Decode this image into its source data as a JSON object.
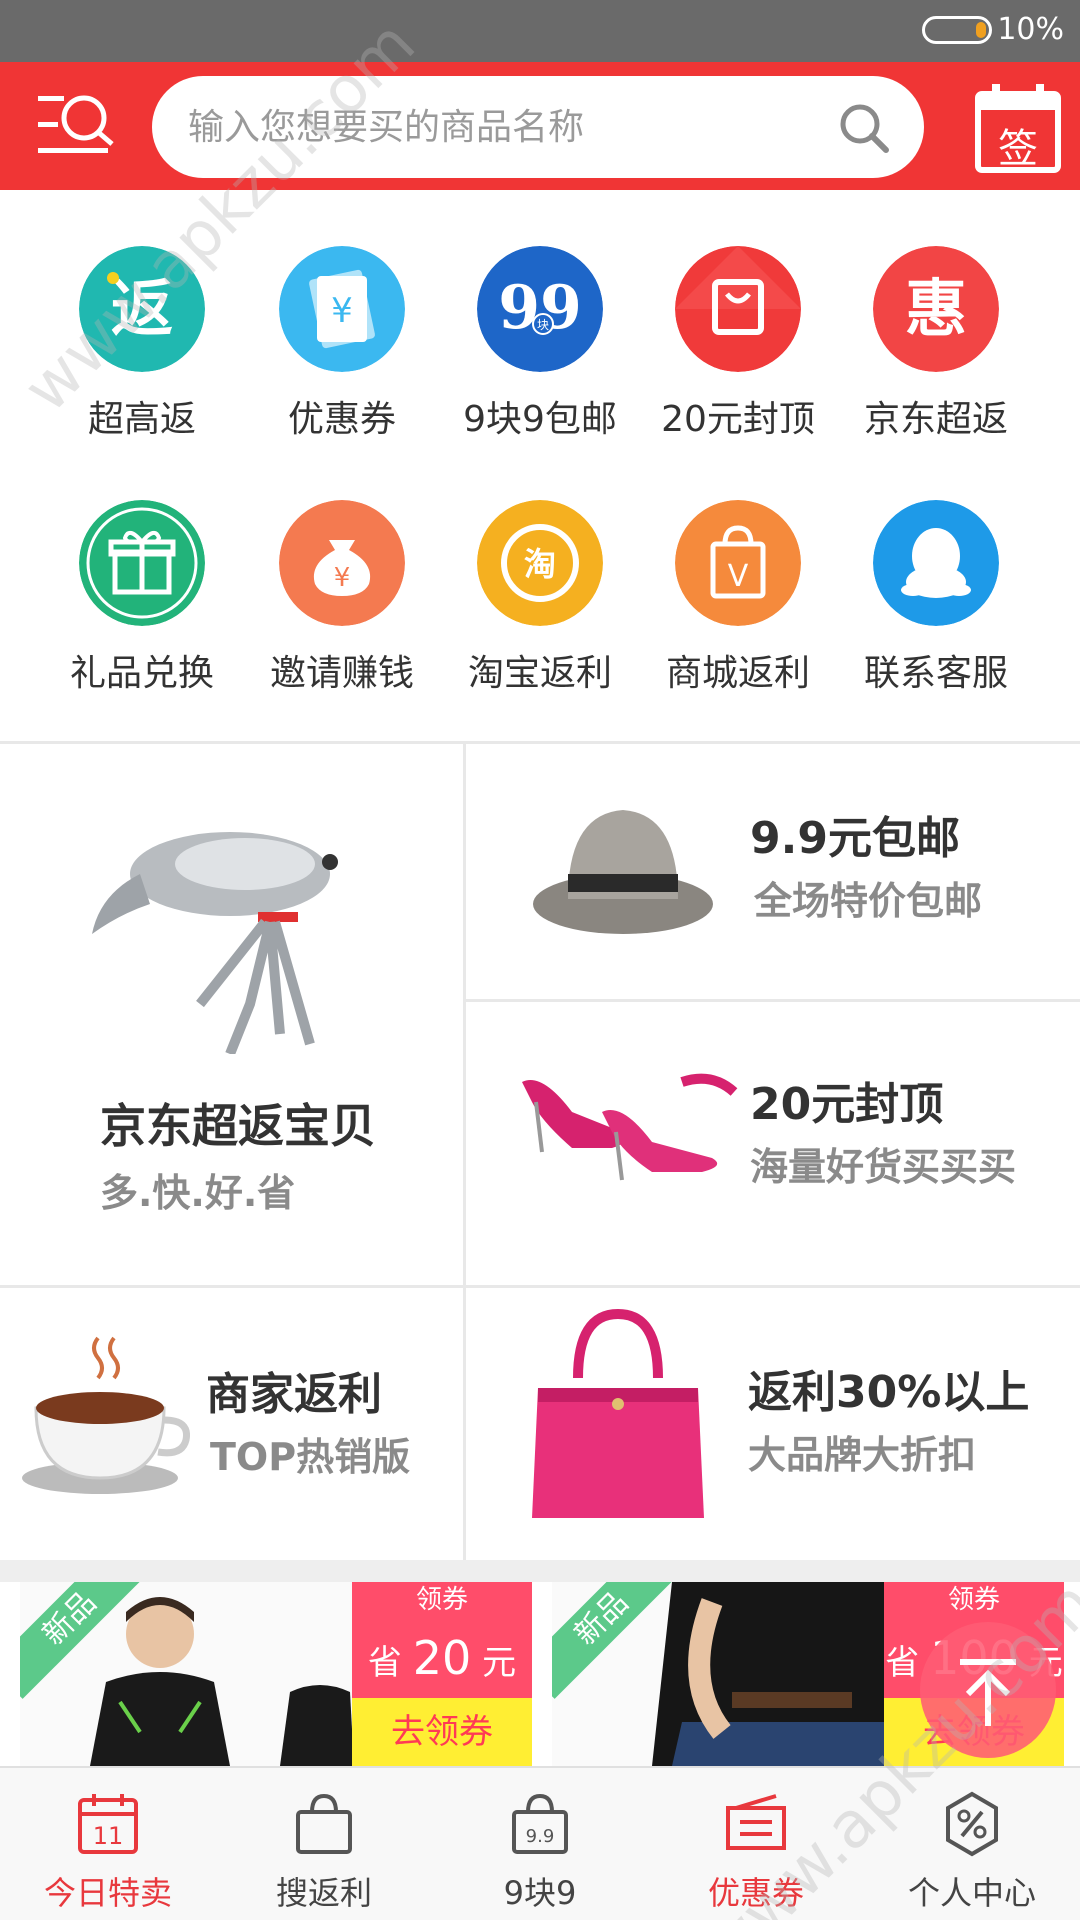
{
  "status_bar": {
    "battery_percent": "10%",
    "battery_level": 0.1
  },
  "header": {
    "search_placeholder": "输入您想要买的商品名称",
    "sign_label": "签",
    "icons": {
      "menu": "search-menu-icon",
      "search": "search-icon",
      "sign": "calendar-sign-icon"
    }
  },
  "grid": {
    "items": [
      {
        "label": "超高返",
        "icon": "fan-icon",
        "glyph": "返",
        "color": "#20b8b0"
      },
      {
        "label": "优惠券",
        "icon": "coupon-ticket-icon",
        "glyph": "¥",
        "color": "#3bb8f0"
      },
      {
        "label": "9块9包邮",
        "icon": "nine-nine-icon",
        "glyph": "99",
        "sub_glyph": "块",
        "color": "#1e66c8"
      },
      {
        "label": "20元封顶",
        "icon": "bag-icon",
        "color": "#f03a3a"
      },
      {
        "label": "京东超返",
        "icon": "hui-icon",
        "glyph": "惠",
        "color": "#f24545"
      },
      {
        "label": "礼品兑换",
        "icon": "gift-icon",
        "color": "#22b37a"
      },
      {
        "label": "邀请赚钱",
        "icon": "money-bag-icon",
        "glyph": "¥",
        "color": "#f47a50"
      },
      {
        "label": "淘宝返利",
        "icon": "taobao-icon",
        "glyph": "淘",
        "color": "#f5b020"
      },
      {
        "label": "商城返利",
        "icon": "mall-bag-icon",
        "glyph": "V",
        "color": "#f58a3c"
      },
      {
        "label": "联系客服",
        "icon": "qq-penguin-icon",
        "color": "#1e9ae8"
      }
    ]
  },
  "promos": {
    "jd": {
      "title": "京东超返宝贝",
      "subtitle": "多.快.好.省",
      "image": "jd-dog-image"
    },
    "nine": {
      "title": "9.9元包邮",
      "subtitle": "全场特价包邮",
      "image": "hat-image"
    },
    "twenty": {
      "title": "20元封顶",
      "subtitle": "海量好货买买买",
      "image": "high-heels-image"
    },
    "merchant": {
      "title": "商家返利",
      "subtitle": "TOP热销版",
      "image": "coffee-cup-image"
    },
    "rebate": {
      "title": "返利30%以上",
      "subtitle": "大品牌大折扣",
      "image": "handbag-image"
    }
  },
  "coupons": [
    {
      "badge": "新品",
      "top": "领券",
      "save_prefix": "省",
      "amount": "20",
      "unit": "元",
      "action": "去领券"
    },
    {
      "badge": "新品",
      "top": "领券",
      "save_prefix": "省",
      "amount": "100",
      "unit": "元",
      "action": "去领券"
    }
  ],
  "fab": {
    "icon": "arrow-up-icon"
  },
  "tabs": [
    {
      "label": "今日特卖",
      "icon": "calendar-11-icon",
      "active": true
    },
    {
      "label": "搜返利",
      "icon": "shopping-bag-icon",
      "active": false
    },
    {
      "label": "9块9",
      "icon": "bag-9-9-icon",
      "active": false
    },
    {
      "label": "优惠券",
      "icon": "coupon-icon",
      "active": true
    },
    {
      "label": "个人中心",
      "icon": "percent-gear-icon",
      "active": false
    }
  ],
  "colors": {
    "brand_red": "#f03535",
    "active_tab": "#e8383d",
    "coupon_pink": "#ff4d6a",
    "coupon_yellow": "#ffee33"
  },
  "watermark": "www.apkzu.com"
}
